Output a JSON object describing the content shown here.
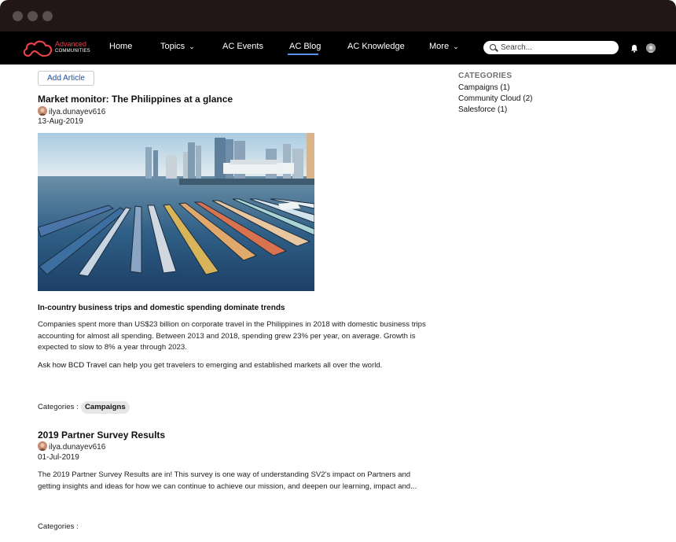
{
  "nav": {
    "logo_text_line1": "Advanced",
    "logo_text_line2": "COMMUNITIES",
    "items": [
      {
        "label": "Home"
      },
      {
        "label": "Topics"
      },
      {
        "label": "AC Events"
      },
      {
        "label": "AC Blog"
      },
      {
        "label": "AC Knowledge"
      },
      {
        "label": "More"
      }
    ],
    "active_item": "AC Blog",
    "search_placeholder": "Search...",
    "accent_color": "#5b8ff2"
  },
  "main": {
    "add_article_label": "Add Article",
    "posts": [
      {
        "title": "Market monitor: The Philippines at a glance",
        "author": "ilya.dunayev616",
        "date": "13-Aug-2019",
        "subheading": "In-country business trips and domestic spending dominate trends",
        "paragraph1": "Companies spent more than US$23 billion on corporate travel in the Philippines in 2018 with domestic business trips accounting for almost all spending. Between 2013 and 2018, spending grew 23% per year, on average. Growth is expected to slow to 8% a year through 2023.",
        "paragraph2_link": "Ask how BCD Travel can help",
        "paragraph2_rest": " you get travelers to emerging and established markets all over the world.",
        "categories_label": "Categories :",
        "categories": [
          "Campaigns"
        ]
      },
      {
        "title": "2019 Partner Survey Results",
        "author": "ilya.dunayev616",
        "date": "01-Jul-2019",
        "paragraph1": "The 2019 Partner Survey Results are in! This survey is one way of understanding SV2's impact on Partners and getting insights and ideas for how we can continue to achieve our mission, and deepen our learning, impact and...",
        "categories_label": "Categories :"
      }
    ]
  },
  "sidebar": {
    "heading": "CATEGORIES",
    "items": [
      {
        "label": "Campaigns (1)"
      },
      {
        "label": "Community Cloud (2)"
      },
      {
        "label": "Salesforce (1)"
      }
    ]
  }
}
